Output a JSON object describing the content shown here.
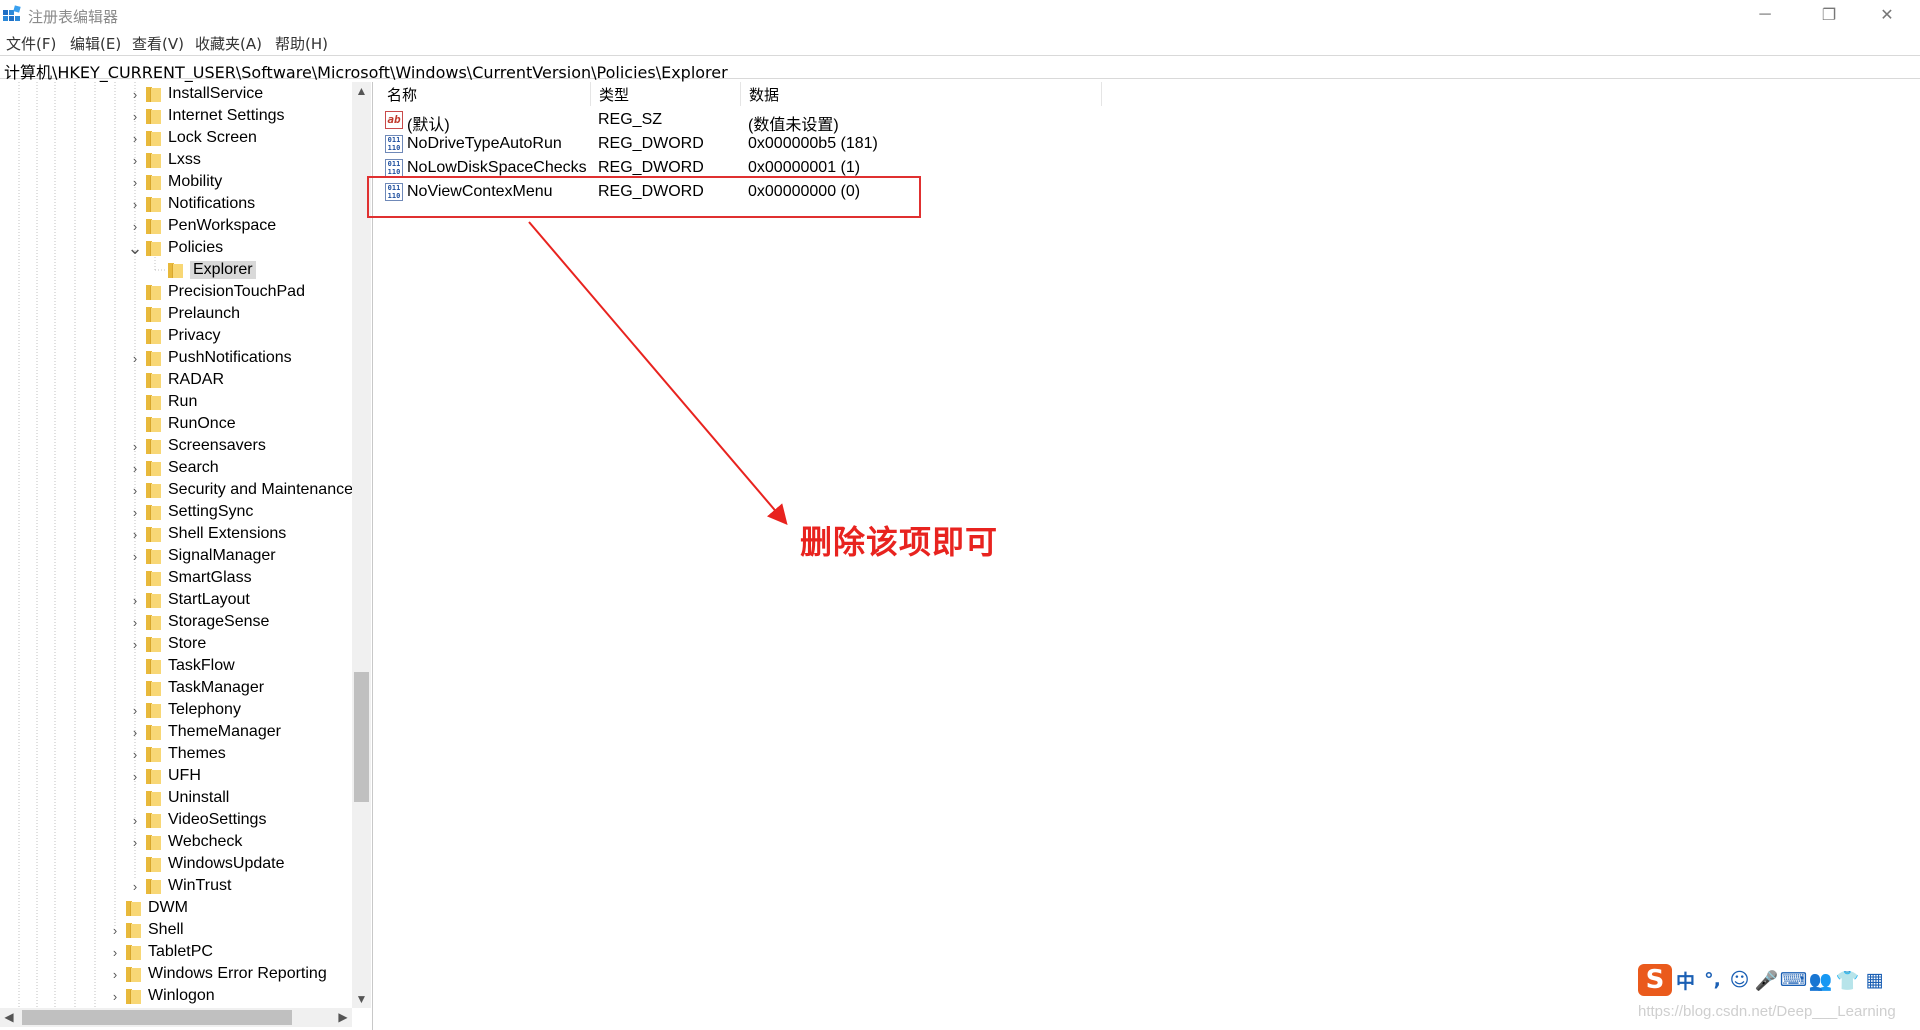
{
  "window": {
    "title": "注册表编辑器",
    "controls": {
      "minimize": "─",
      "maximize": "❐",
      "close": "✕"
    }
  },
  "menu": [
    "文件(F)",
    "编辑(E)",
    "查看(V)",
    "收藏夹(A)",
    "帮助(H)"
  ],
  "address": "计算机\\HKEY_CURRENT_USER\\Software\\Microsoft\\Windows\\CurrentVersion\\Policies\\Explorer",
  "tree": {
    "items": [
      "InstallService",
      "Internet Settings",
      "Lock Screen",
      "Lxss",
      "Mobility",
      "Notifications",
      "PenWorkspace",
      "Policies",
      "Explorer",
      "PrecisionTouchPad",
      "Prelaunch",
      "Privacy",
      "PushNotifications",
      "RADAR",
      "Run",
      "RunOnce",
      "Screensavers",
      "Search",
      "Security and Maintenance",
      "SettingSync",
      "Shell Extensions",
      "SignalManager",
      "SmartGlass",
      "StartLayout",
      "StorageSense",
      "Store",
      "TaskFlow",
      "TaskManager",
      "Telephony",
      "ThemeManager",
      "Themes",
      "UFH",
      "Uninstall",
      "VideoSettings",
      "Webcheck",
      "WindowsUpdate",
      "WinTrust",
      "DWM",
      "Shell",
      "TabletPC",
      "Windows Error Reporting",
      "Winlogon"
    ],
    "selected": "Explorer"
  },
  "values": {
    "columns": [
      "名称",
      "类型",
      "数据"
    ],
    "rows": [
      {
        "icon": "string-value-icon",
        "name": "(默认)",
        "type": "REG_SZ",
        "data": "(数值未设置)"
      },
      {
        "icon": "dword-value-icon",
        "name": "NoDriveTypeAutoRun",
        "type": "REG_DWORD",
        "data": "0x000000b5 (181)"
      },
      {
        "icon": "dword-value-icon",
        "name": "NoLowDiskSpaceChecks",
        "type": "REG_DWORD",
        "data": "0x00000001 (1)"
      },
      {
        "icon": "dword-value-icon",
        "name": "NoViewContexMenu",
        "type": "REG_DWORD",
        "data": "0x00000000 (0)"
      }
    ]
  },
  "annotation": "删除该项即可",
  "ime": {
    "logo": "S",
    "items": [
      "中",
      "°,",
      "☺",
      "🎤",
      "⌨",
      "👥",
      "👕",
      "▦"
    ]
  },
  "watermark": "https://blog.csdn.net/Deep___Learning",
  "colors": {
    "annotation": "#e8231f",
    "folder": "#f8d775",
    "selection": "#d9d9d9"
  }
}
